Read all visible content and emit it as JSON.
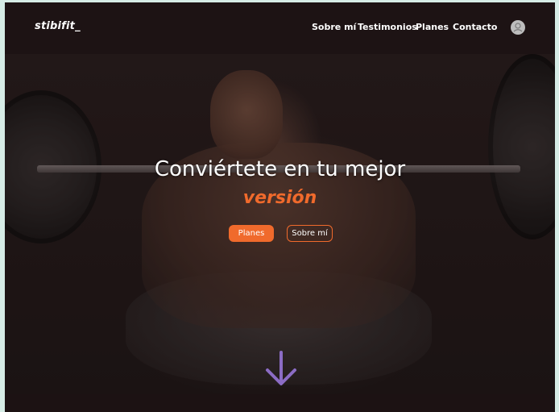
{
  "navbar": {
    "logo": "stibifit_",
    "links": [
      "Sobre mí",
      "Testimonios",
      "Planes",
      "Contacto"
    ],
    "avatar_icon": "user-icon"
  },
  "hero": {
    "headline": "Conviértete en tu mejor",
    "highlight": "versión",
    "primary_button": "Planes",
    "secondary_button": "Sobre mí",
    "scroll_icon": "arrow-down-icon"
  },
  "colors": {
    "accent": "#f06a2c",
    "arrow": "#8b6cc4",
    "background": "#1c1213",
    "page_border": "#d6ece6"
  }
}
